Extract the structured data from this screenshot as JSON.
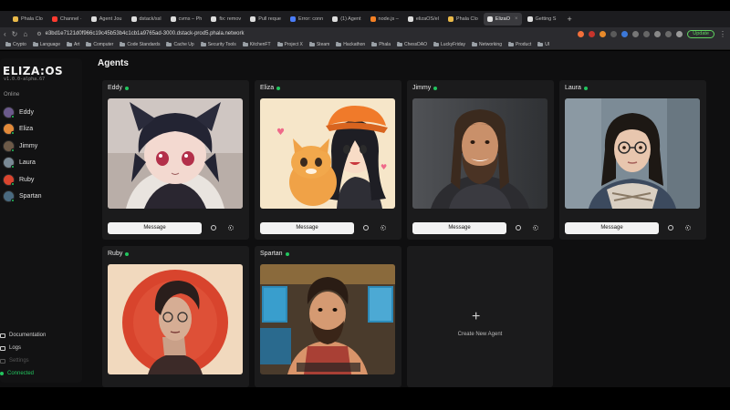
{
  "browser": {
    "tabs": [
      {
        "label": "Phala Clo",
        "color": "#e9b949"
      },
      {
        "label": "Channel ·",
        "color": "#ff3b30"
      },
      {
        "label": "Agent Jou",
        "color": "#dddddd"
      },
      {
        "label": "dstack/ssl",
        "color": "#dddddd"
      },
      {
        "label": "cvms – Ph",
        "color": "#dddddd"
      },
      {
        "label": "fix: remov",
        "color": "#dddddd"
      },
      {
        "label": "Pull reque",
        "color": "#dddddd"
      },
      {
        "label": "Error: conn",
        "color": "#4a7cf7"
      },
      {
        "label": "(1) Agent",
        "color": "#dddddd"
      },
      {
        "label": "node.js –",
        "color": "#f48024"
      },
      {
        "label": "elizaOS/el",
        "color": "#dddddd"
      },
      {
        "label": "Phala Clo",
        "color": "#e9b949"
      },
      {
        "label": "ElizaO",
        "color": "#dddddd",
        "active": true
      },
      {
        "label": "Getting S",
        "color": "#dddddd"
      }
    ],
    "new_tab": "+",
    "url": "e3bd1e7121d0f966c19c45b53b4c1cb1a9765ad-3000.dstack-prod5.phala.network",
    "update_label": "Update",
    "bookmarks": [
      "Crypto",
      "Language",
      "Art",
      "Computer",
      "Code Standards",
      "Cache Up",
      "Security Tools",
      "KitchenFT",
      "Project X",
      "Steam",
      "Hackathon",
      "Phala",
      "ChessDAO",
      "LuckyFriday",
      "Networking",
      "Product",
      "UI"
    ]
  },
  "sidebar": {
    "logo": "ELIZA:OS",
    "version": "v1.0.0-alpha.67",
    "online_label": "Online",
    "agents": [
      {
        "name": "Eddy",
        "color": "#6b5a8c"
      },
      {
        "name": "Eliza",
        "color": "#e38a3a"
      },
      {
        "name": "Jimmy",
        "color": "#6d5a48"
      },
      {
        "name": "Laura",
        "color": "#7a8a96"
      },
      {
        "name": "Ruby",
        "color": "#d9452f"
      },
      {
        "name": "Spartan",
        "color": "#4a6a80"
      }
    ],
    "links": {
      "documentation": "Documentation",
      "logs": "Logs",
      "settings": "Settings",
      "connected": "Connected"
    }
  },
  "main": {
    "title": "Agents",
    "message_label": "Message",
    "cards": [
      {
        "name": "Eddy"
      },
      {
        "name": "Eliza"
      },
      {
        "name": "Jimmy"
      },
      {
        "name": "Laura"
      },
      {
        "name": "Ruby"
      },
      {
        "name": "Spartan"
      }
    ],
    "create_label": "Create New Agent",
    "create_plus": "+"
  }
}
